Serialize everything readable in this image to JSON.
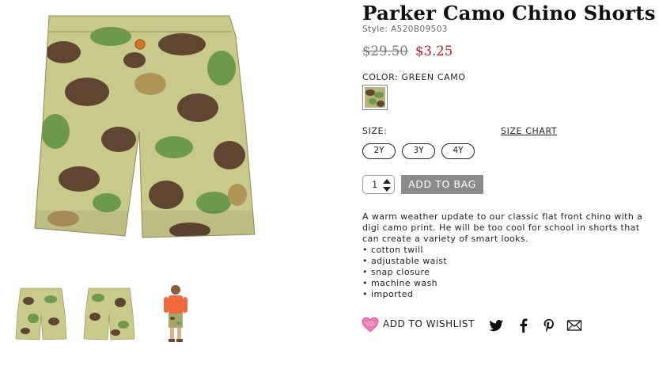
{
  "product": {
    "title": "Parker Camo Chino Shorts",
    "style": "Style: A520B09503",
    "old_price": "$29.50",
    "sale_price": "$3.25",
    "color_label": "COLOR: GREEN CAMO",
    "size_label": "SIZE:",
    "size_chart": "SIZE CHART",
    "sizes": [
      "2Y",
      "3Y",
      "4Y"
    ],
    "quantity": "1",
    "add_to_bag": "ADD TO BAG",
    "description": "A warm weather update to our classic flat front chino with a digi camo print. He will be too cool for school in shorts that can create a variety of smart looks.",
    "features": [
      "cotton twill",
      "adjustable waist",
      "snap closure",
      "machine wash",
      "imported"
    ],
    "wishlist": "ADD TO WISHLIST"
  },
  "colors": {
    "sale_price": "#b0202a",
    "add_to_bag_bg": "#8a8a8a",
    "wishlist_heart": "#e85aa0",
    "camo_base": "#c9c98a",
    "camo_dark": "#5e4632",
    "camo_green": "#6c9a4a",
    "camo_tan": "#b0955a"
  },
  "icons": {
    "share": [
      "twitter-icon",
      "facebook-icon",
      "pinterest-icon",
      "email-icon"
    ],
    "wishlist": "heart-icon",
    "quantity": "stepper-arrows-icon"
  }
}
